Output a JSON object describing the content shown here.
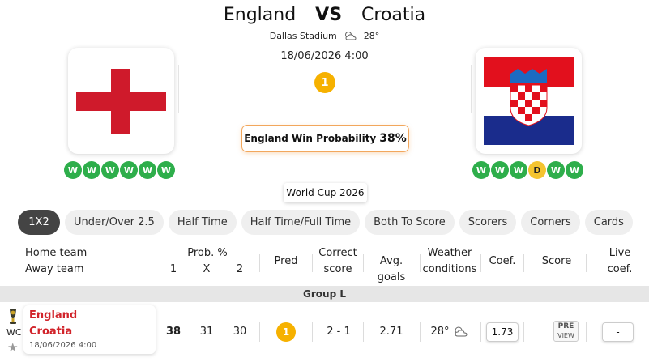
{
  "match": {
    "home_team": "England",
    "vs": "VS",
    "away_team": "Croatia",
    "venue": "Dallas Stadium",
    "weather_icon": "partly-cloudy-icon",
    "temperature": "28°",
    "datetime": "18/06/2026 4:00",
    "prediction": "1",
    "win_probability_label": "England Win Probability",
    "win_probability_value": "38%",
    "competition": "World Cup 2026"
  },
  "home_form": [
    "W",
    "W",
    "W",
    "W",
    "W",
    "W"
  ],
  "away_form": [
    "W",
    "W",
    "W",
    "D",
    "W",
    "W"
  ],
  "tabs": [
    {
      "label": "1X2",
      "active": true
    },
    {
      "label": "Under/Over 2.5",
      "active": false
    },
    {
      "label": "Half Time",
      "active": false
    },
    {
      "label": "Half Time/Full Time",
      "active": false
    },
    {
      "label": "Both To Score",
      "active": false
    },
    {
      "label": "Scorers",
      "active": false
    },
    {
      "label": "Corners",
      "active": false
    },
    {
      "label": "Cards",
      "active": false
    }
  ],
  "table_header": {
    "home_team": "Home team",
    "away_team": "Away team",
    "prob": "Prob. %",
    "prob_1": "1",
    "prob_x": "X",
    "prob_2": "2",
    "pred": "Pred",
    "correct_score_1": "Correct",
    "correct_score_2": "score",
    "avg_goals": "Avg. goals",
    "weather_1": "Weather",
    "weather_2": "conditions",
    "coef": "Coef.",
    "score": "Score",
    "live_coef_1": "Live",
    "live_coef_2": "coef."
  },
  "group_label": "Group L",
  "row": {
    "competition_short": "WC",
    "home": "England",
    "away": "Croatia",
    "datetime": "18/06/2026 4:00",
    "prob_1": "38",
    "prob_x": "31",
    "prob_2": "30",
    "pred": "1",
    "correct_score": "2 - 1",
    "avg_goals": "2.71",
    "temperature": "28°",
    "coef": "1.73",
    "score_pre": "PRE",
    "score_view": "VIEW",
    "live_coef": "-"
  },
  "colors": {
    "accent_orange": "#f6b100",
    "win_green": "#2eae4b",
    "draw_yellow": "#f4c430",
    "team_red": "#d1232a",
    "active_tab": "#444444"
  }
}
